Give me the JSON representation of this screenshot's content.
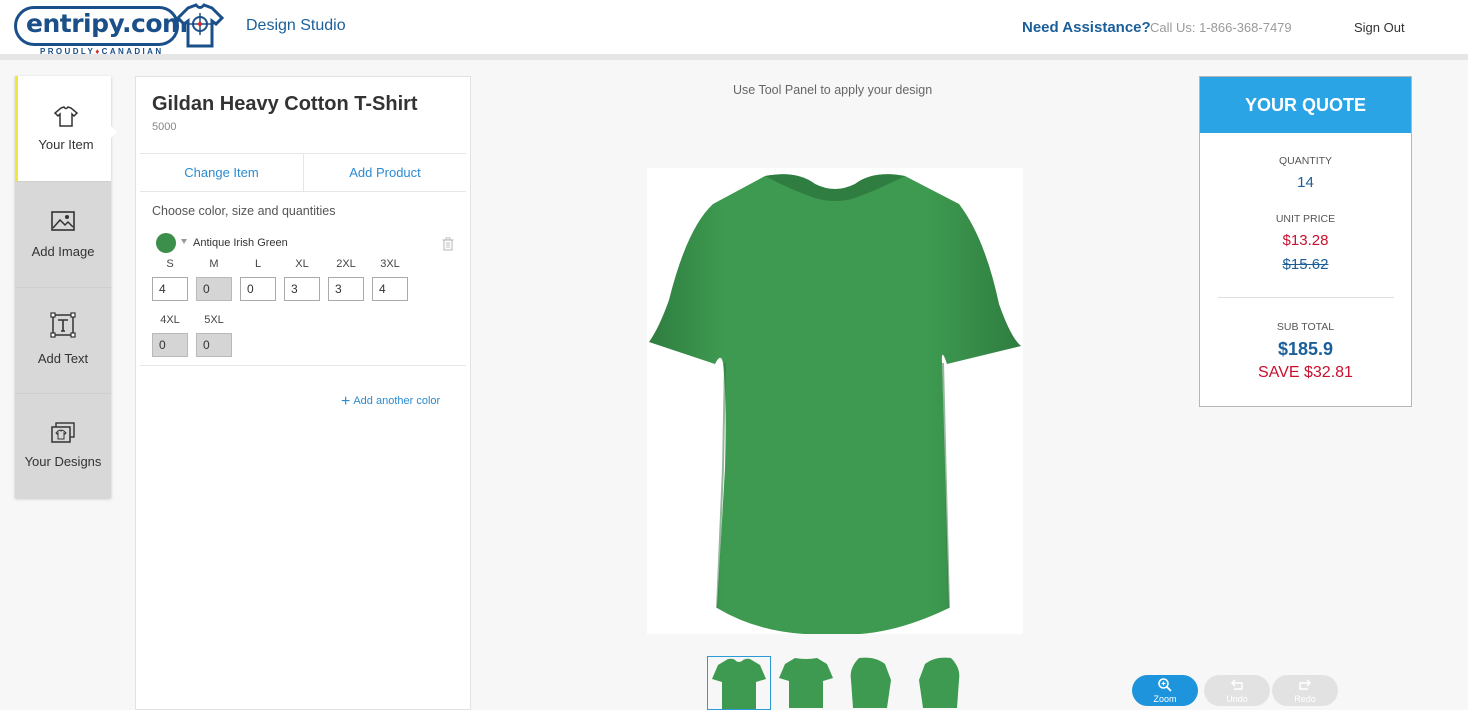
{
  "header": {
    "logo_text": "entripy.com",
    "logo_sub_left": "PROUDLY",
    "logo_sub_right": "CANADIAN",
    "studio": "Design Studio",
    "assist": "Need Assistance?",
    "call": "Call Us: 1-866-368-7479",
    "signout": "Sign Out"
  },
  "tools": [
    {
      "label": "Your Item",
      "icon": "tshirt-icon"
    },
    {
      "label": "Add Image",
      "icon": "image-icon"
    },
    {
      "label": "Add Text",
      "icon": "text-icon"
    },
    {
      "label": "Your Designs",
      "icon": "designs-icon"
    }
  ],
  "item": {
    "title": "Gildan Heavy Cotton T-Shirt",
    "code": "5000",
    "tab_change": "Change Item",
    "tab_add": "Add Product",
    "choose": "Choose color, size and quantities",
    "color_name": "Antique Irish Green",
    "color_hex": "#3b8f4a",
    "sizes": [
      {
        "label": "S",
        "qty": "4"
      },
      {
        "label": "M",
        "qty": "0"
      },
      {
        "label": "L",
        "qty": "0"
      },
      {
        "label": "XL",
        "qty": "3"
      },
      {
        "label": "2XL",
        "qty": "3"
      },
      {
        "label": "3XL",
        "qty": "4"
      },
      {
        "label": "4XL",
        "qty": "0"
      },
      {
        "label": "5XL",
        "qty": "0"
      }
    ],
    "add_color": "Add another color"
  },
  "canvas": {
    "hint": "Use Tool Panel to apply your design",
    "shirt_color": "#3e9a50"
  },
  "quote": {
    "title": "YOUR QUOTE",
    "quantity_label": "QUANTITY",
    "quantity": "14",
    "unit_label": "UNIT PRICE",
    "unit_price": "$13.28",
    "unit_orig": "$15.62",
    "sub_label": "SUB TOTAL",
    "sub_total": "$185.9",
    "save": "SAVE $32.81"
  },
  "controls": {
    "zoom": "Zoom",
    "undo": "Undo",
    "redo": "Redo"
  },
  "colors": {
    "brand_blue": "#1b5f9a",
    "accent_blue": "#2ba4e6",
    "price_red": "#c8102e"
  }
}
